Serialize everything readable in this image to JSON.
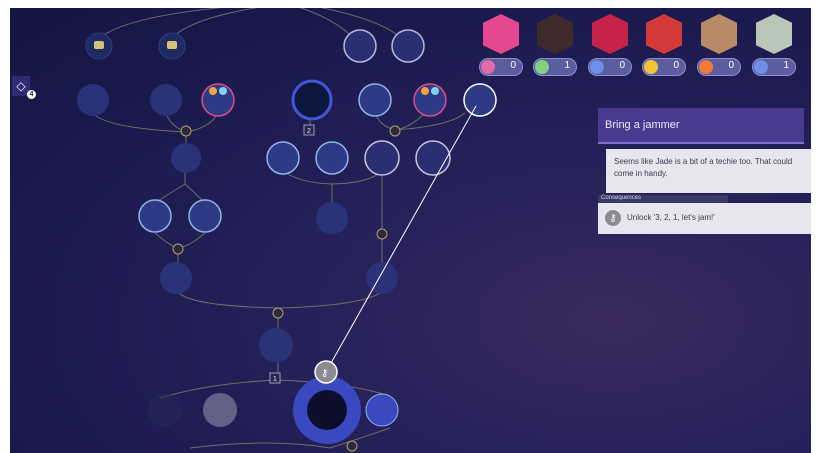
{
  "side_marker": {
    "icon": "diamond-icon",
    "count": "4"
  },
  "party": [
    {
      "name": "pink-haired",
      "portrait_color": "#e5488f",
      "item_icon": "pink-orb-icon",
      "item_color": "#e66aa8",
      "count": "0"
    },
    {
      "name": "dark-skinned",
      "portrait_color": "#3e2a2a",
      "item_icon": "green-leaf-icon",
      "item_color": "#7fd27f",
      "count": "1"
    },
    {
      "name": "masked-red-eyes",
      "portrait_color": "#c6234b",
      "item_icon": "blue-crystal-icon",
      "item_color": "#6f8ee8",
      "count": "0"
    },
    {
      "name": "long-dark-hair",
      "portrait_color": "#d43a3a",
      "item_icon": "yellow-gem-icon",
      "item_color": "#f2c23a",
      "count": "0"
    },
    {
      "name": "bald-beard",
      "portrait_color": "#b98a67",
      "item_icon": "orange-blade-icon",
      "item_color": "#ef7a3a",
      "count": "0"
    },
    {
      "name": "old-pale",
      "portrait_color": "#b8c7b8",
      "item_icon": "blue-crystal-icon",
      "item_color": "#6f8ee8",
      "count": "1"
    }
  ],
  "tooltip": {
    "title": "Bring a jammer",
    "body": "Seems like Jade is a bit of a techie too. That could come in handy.",
    "consequences_label": "Consequences",
    "consequence_icon": "key-icon",
    "consequence_text": "Unlock '3, 2, 1, let's jam!'"
  },
  "tree": {
    "node_count_marker": "2",
    "unlock_marker": "1",
    "selected_node_icon": "key-icon"
  }
}
